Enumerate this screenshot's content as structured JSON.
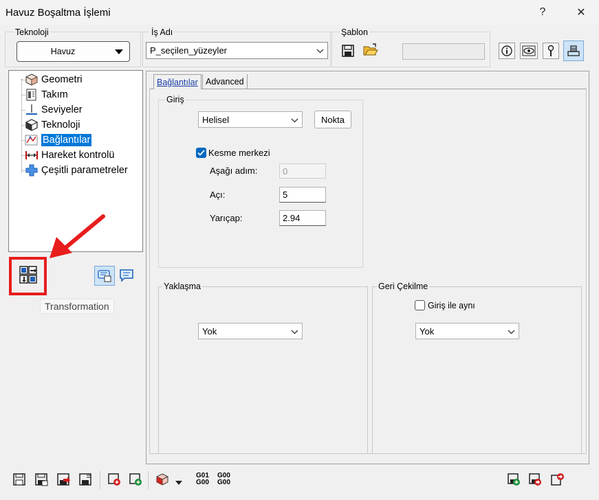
{
  "window": {
    "title": "Havuz Boşaltma İşlemi",
    "help": "?",
    "close": "✕"
  },
  "teknoloji": {
    "label": "Teknoloji",
    "value": "Havuz"
  },
  "is_adi": {
    "label": "İş Adı",
    "value": "P_seçilen_yüzeyler"
  },
  "sablon": {
    "label": "Şablon",
    "field_value": ""
  },
  "tree": {
    "items": [
      {
        "label": "Geometri",
        "icon": "cube-icon"
      },
      {
        "label": "Takım",
        "icon": "tool-holder-icon"
      },
      {
        "label": "Seviyeler",
        "icon": "levels-icon"
      },
      {
        "label": "Teknoloji",
        "icon": "technology-cube-icon"
      },
      {
        "label": "Bağlantılar",
        "icon": "links-icon",
        "selected": true
      },
      {
        "label": "Hareket kontrolü",
        "icon": "motion-control-icon"
      },
      {
        "label": "Çeşitli parametreler",
        "icon": "plus-icon"
      }
    ]
  },
  "tooltip": {
    "text": "Transformation"
  },
  "tabs": [
    {
      "label": "Bağlantılar",
      "active": true
    },
    {
      "label": "Advanced",
      "active": false
    }
  ],
  "giris": {
    "label": "Giriş",
    "type_value": "Helisel",
    "nokta_button": "Nokta",
    "kesme_merkezi": {
      "label": "Kesme merkezi",
      "checked": true
    },
    "asagi_adim": {
      "label": "Aşağı adım:",
      "value": "0"
    },
    "aci": {
      "label": "Açı:",
      "value": "5"
    },
    "yaricap": {
      "label": "Yarıçap:",
      "value": "2.94"
    }
  },
  "yaklasma": {
    "label": "Yaklaşma",
    "value": "Yok"
  },
  "geri_cekilme": {
    "label": "Geri Çekilme",
    "same_as_entry": {
      "label": "Giriş ile aynı",
      "checked": false
    },
    "value": "Yok"
  },
  "toolbar": {
    "g01_top": "G01",
    "g01_bottom": "G00",
    "g00_top": "G00",
    "g00_bottom": "G00"
  },
  "colors": {
    "accent": "#0078d7",
    "annotation_red": "#e81d1d"
  }
}
